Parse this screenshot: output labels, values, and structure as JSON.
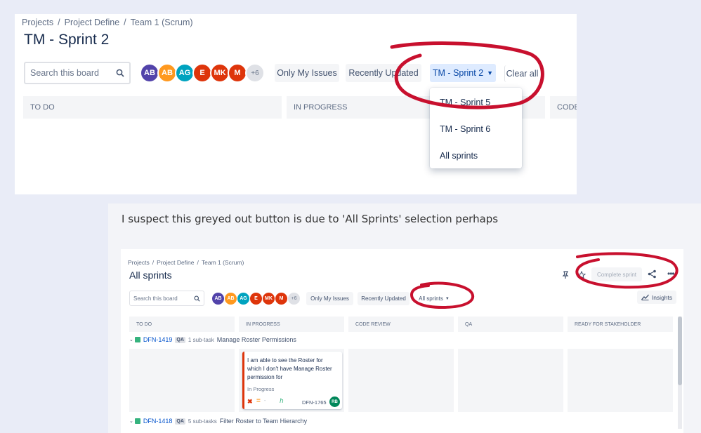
{
  "top": {
    "breadcrumb": [
      "Projects",
      "Project Define",
      "Team 1 (Scrum)"
    ],
    "title": "TM - Sprint 2",
    "search_placeholder": "Search this board",
    "avatars": [
      {
        "initials": "AB",
        "color": "#5243aa"
      },
      {
        "initials": "AB",
        "color": "#ff991f"
      },
      {
        "initials": "AG",
        "color": "#00a3bf"
      },
      {
        "initials": "E",
        "color": "#de350b"
      },
      {
        "initials": "MK",
        "color": "#de350b"
      },
      {
        "initials": "M",
        "color": "#de350b"
      }
    ],
    "more_avatars": "+6",
    "only_my_issues": "Only My Issues",
    "recently_updated": "Recently Updated",
    "sprint_select": "TM - Sprint 2",
    "clear_all": "Clear all",
    "columns": [
      "TO DO",
      "IN PROGRESS",
      "CODE REVIEW"
    ],
    "dropdown_items": [
      "TM - Sprint 5",
      "TM - Sprint 6",
      "All sprints"
    ]
  },
  "note": "I suspect this greyed out button is due to 'All Sprints' selection perhaps",
  "bottom": {
    "breadcrumb": [
      "Projects",
      "Project Define",
      "Team 1 (Scrum)"
    ],
    "title": "All sprints",
    "complete_sprint": "Complete sprint",
    "search_placeholder": "Search this board",
    "avatars": [
      {
        "initials": "AB",
        "color": "#5243aa"
      },
      {
        "initials": "AB",
        "color": "#ff991f"
      },
      {
        "initials": "AG",
        "color": "#00a3bf"
      },
      {
        "initials": "E",
        "color": "#de350b"
      },
      {
        "initials": "MK",
        "color": "#de350b"
      },
      {
        "initials": "M",
        "color": "#de350b"
      }
    ],
    "more_avatars": "+6",
    "only_my_issues": "Only My Issues",
    "recently_updated": "Recently Updated",
    "sprint_select": "All sprints",
    "insights": "Insights",
    "columns": [
      "TO DO",
      "IN PROGRESS",
      "CODE REVIEW",
      "QA",
      "READY FOR STAKEHOLDER"
    ],
    "swimlanes": [
      {
        "key": "DFN-1419",
        "tag": "QA",
        "subtasks": "1 sub-task",
        "summary": "Manage Roster Permissions"
      },
      {
        "key": "DFN-1418",
        "tag": "QA",
        "subtasks": "5 sub-tasks",
        "summary": "Filter Roster to Team Hierarchy"
      }
    ],
    "card": {
      "summary": "I am able to see the Roster for which I don't have Manage Roster permission for",
      "status": "In Progress",
      "key": "DFN-1765",
      "assignee": "RB"
    }
  },
  "colors": {
    "annotation": "#c8102e",
    "selected": "#deebff",
    "accent": "#0052cc"
  }
}
